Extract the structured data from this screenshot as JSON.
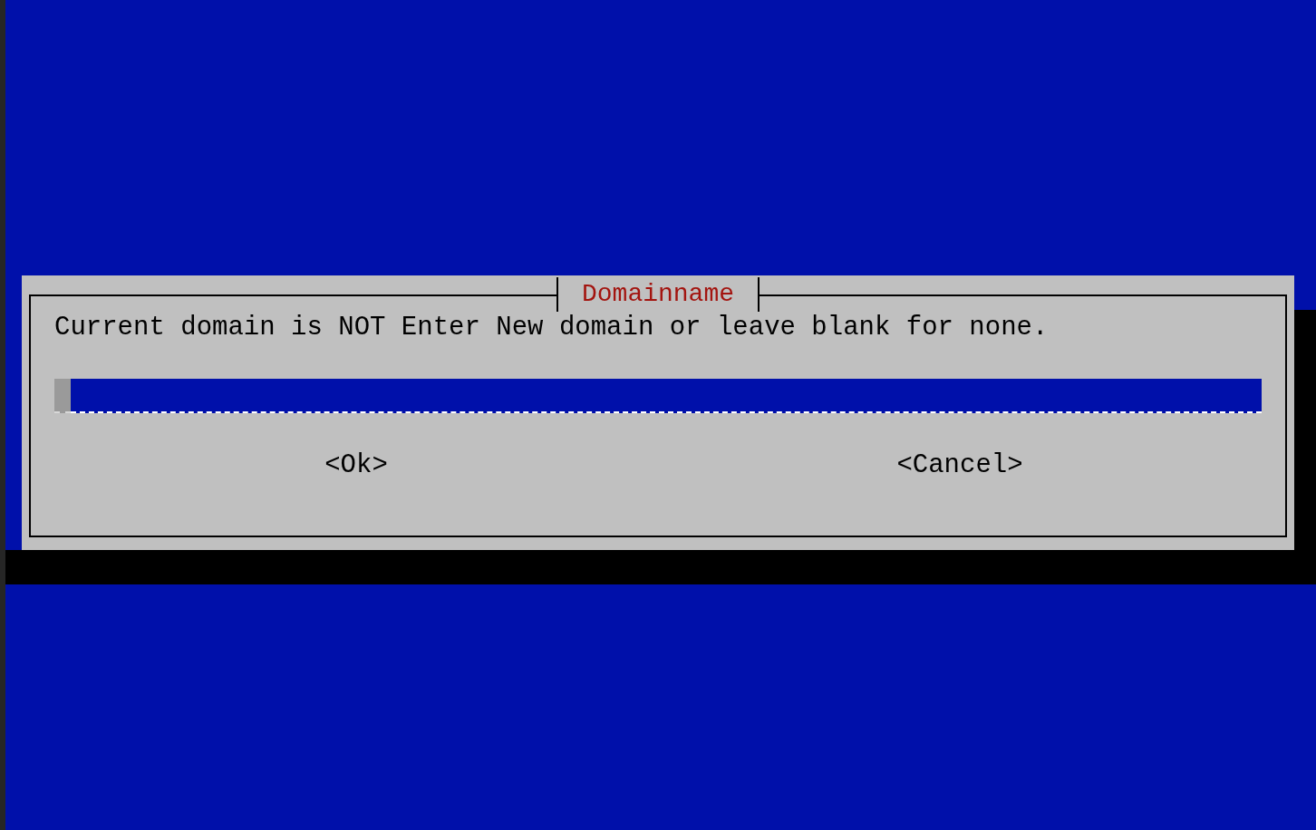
{
  "dialog": {
    "title": "Domainname",
    "message": "Current domain is NOT Enter New domain or leave blank for none.",
    "input": {
      "focused": true
    },
    "buttons": [
      {
        "label": "<Ok>"
      },
      {
        "label": "<Cancel>"
      }
    ]
  }
}
